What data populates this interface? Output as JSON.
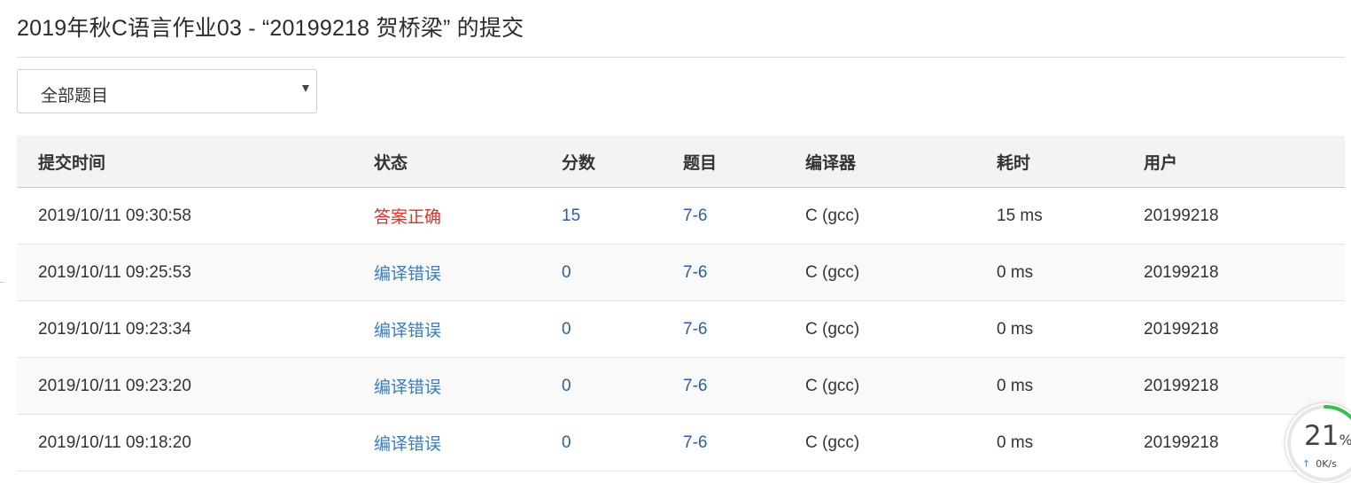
{
  "page": {
    "title": "2019年秋C语言作业03 - “20199218 贺桥梁” 的提交"
  },
  "filter": {
    "selected": "全部题目"
  },
  "table": {
    "headers": [
      "提交时间",
      "状态",
      "分数",
      "题目",
      "编译器",
      "耗时",
      "用户"
    ],
    "rows": [
      {
        "time": "2019/10/11 09:30:58",
        "status": "答案正确",
        "score": "15",
        "problem": "7-6",
        "compiler": "C (gcc)",
        "duration": "15 ms",
        "user": "20199218"
      },
      {
        "time": "2019/10/11 09:25:53",
        "status": "编译错误",
        "score": "0",
        "problem": "7-6",
        "compiler": "C (gcc)",
        "duration": "0 ms",
        "user": "20199218"
      },
      {
        "time": "2019/10/11 09:23:34",
        "status": "编译错误",
        "score": "0",
        "problem": "7-6",
        "compiler": "C (gcc)",
        "duration": "0 ms",
        "user": "20199218"
      },
      {
        "time": "2019/10/11 09:23:20",
        "status": "编译错误",
        "score": "0",
        "problem": "7-6",
        "compiler": "C (gcc)",
        "duration": "0 ms",
        "user": "20199218"
      },
      {
        "time": "2019/10/11 09:18:20",
        "status": "编译错误",
        "score": "0",
        "problem": "7-6",
        "compiler": "C (gcc)",
        "duration": "0 ms",
        "user": "20199218"
      }
    ]
  },
  "speed_widget": {
    "percent": "21",
    "percent_sign": "%",
    "net_speed": "0K/s",
    "usage_fraction": 0.21
  },
  "colors": {
    "status_accepted": "#d9322b",
    "status_compile_error": "#3a7cc0",
    "link": "#2a5f9e",
    "widget_ring": "#33c24d"
  }
}
